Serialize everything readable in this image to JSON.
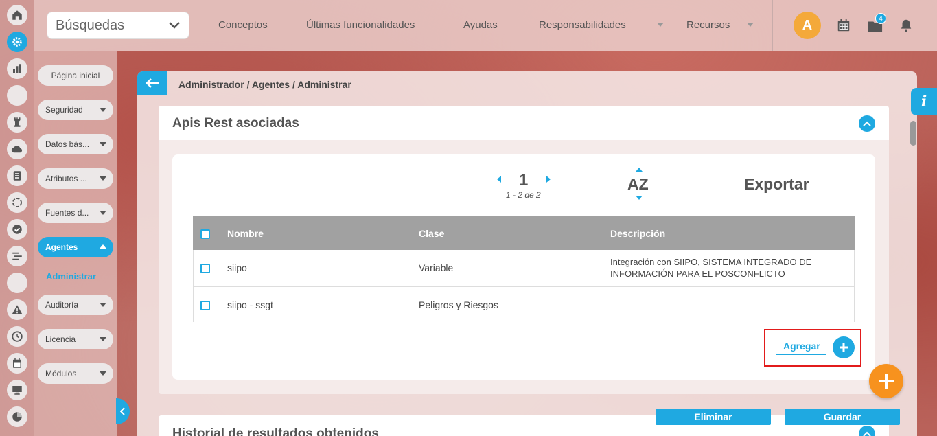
{
  "topbar": {
    "search_label": "Búsquedas",
    "nav": [
      "Conceptos",
      "Últimas funcionalidades",
      "Ayudas",
      "Responsabilidades",
      "Recursos"
    ],
    "avatar_letter": "A",
    "notification_count": "4"
  },
  "sidebar": {
    "items": [
      {
        "label": "Página inicial"
      },
      {
        "label": "Seguridad"
      },
      {
        "label": "Datos bás..."
      },
      {
        "label": "Atributos ..."
      },
      {
        "label": "Fuentes d..."
      },
      {
        "label": "Agentes"
      },
      {
        "label": "Auditoría"
      },
      {
        "label": "Licencia"
      },
      {
        "label": "Módulos"
      }
    ],
    "subitem": "Administrar"
  },
  "breadcrumb": "Administrador / Agentes / Administrar",
  "section": {
    "title": "Apis Rest asociadas",
    "pagination": {
      "page": "1",
      "range": "1 - 2 de 2"
    },
    "sort_label": "AZ",
    "export_label": "Exportar",
    "table": {
      "headers": [
        "Nombre",
        "Clase",
        "Descripción"
      ],
      "rows": [
        {
          "nombre": "siipo",
          "clase": "Variable",
          "descripcion_1": "Integración con SIIPO, SISTEMA INTEGRADO DE",
          "descripcion_2": "INFORMACIÓN PARA EL POSCONFLICTO"
        },
        {
          "nombre": "siipo - ssgt",
          "clase": "Peligros y Riesgos",
          "descripcion_1": "",
          "descripcion_2": ""
        }
      ]
    },
    "add_label": "Agregar"
  },
  "section2": {
    "title": "Historial de resultados obtenidos"
  },
  "actions": {
    "delete_label": "Eliminar",
    "save_label": "Guardar"
  },
  "info_label": "i",
  "colors": {
    "accent": "#1fa9e1",
    "fab": "#f7921e",
    "highlight": "#e21b1b"
  }
}
